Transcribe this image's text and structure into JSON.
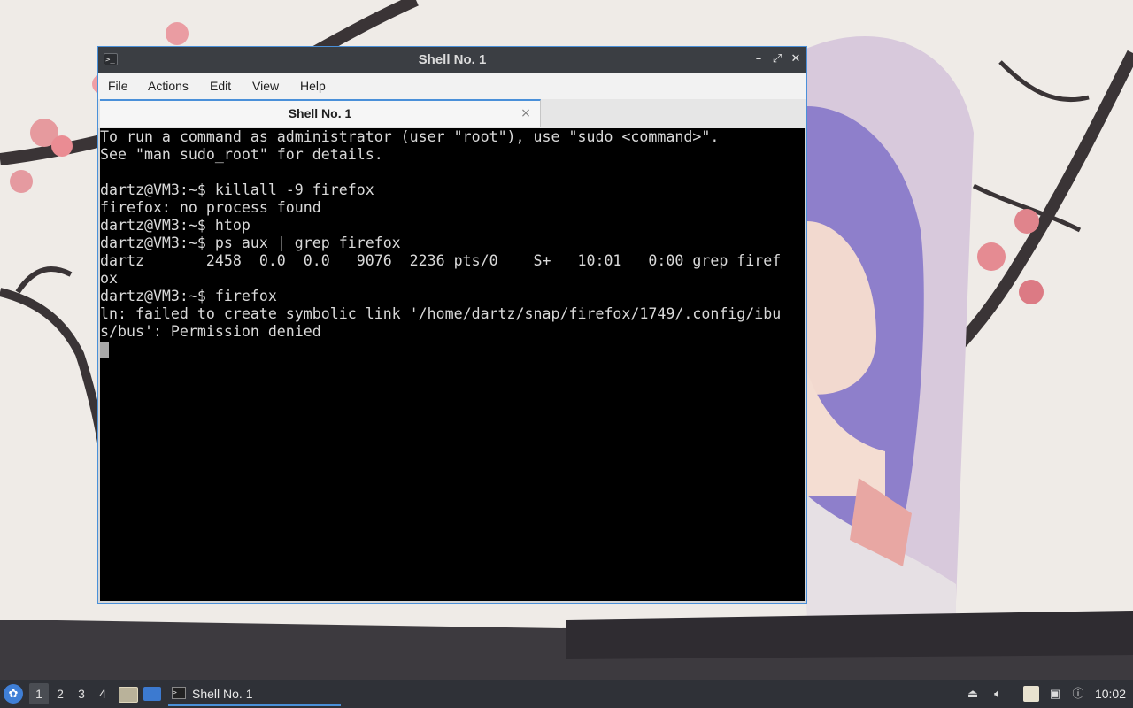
{
  "window": {
    "title": "Shell No. 1",
    "controls": {
      "minimize": "–",
      "maximize": "⤢",
      "close": "✕"
    }
  },
  "menubar": {
    "items": [
      "File",
      "Actions",
      "Edit",
      "View",
      "Help"
    ]
  },
  "tabs": [
    {
      "label": "Shell No. 1",
      "close": "×"
    }
  ],
  "terminal": {
    "lines": [
      "To run a command as administrator (user \"root\"), use \"sudo <command>\".",
      "See \"man sudo_root\" for details.",
      "",
      "dartz@VM3:~$ killall -9 firefox",
      "firefox: no process found",
      "dartz@VM3:~$ htop",
      "dartz@VM3:~$ ps aux | grep firefox",
      "dartz       2458  0.0  0.0   9076  2236 pts/0    S+   10:01   0:00 grep firef",
      "ox",
      "dartz@VM3:~$ firefox",
      "ln: failed to create symbolic link '/home/dartz/snap/firefox/1749/.config/ibu",
      "s/bus': Permission denied"
    ]
  },
  "taskbar": {
    "workspaces": [
      "1",
      "2",
      "3",
      "4"
    ],
    "active_workspace": "1",
    "task_label": "Shell No. 1",
    "clock": "10:02",
    "tray_icons": [
      "mount-icon",
      "volume-icon",
      "clipboard-icon",
      "network-icon",
      "update-notifier-icon"
    ]
  },
  "colors": {
    "accent": "#4a90d9",
    "titlebar": "#3b3e43",
    "terminal_bg": "#000000",
    "terminal_fg": "#d9d9d9",
    "taskbar": "#2f3137"
  }
}
